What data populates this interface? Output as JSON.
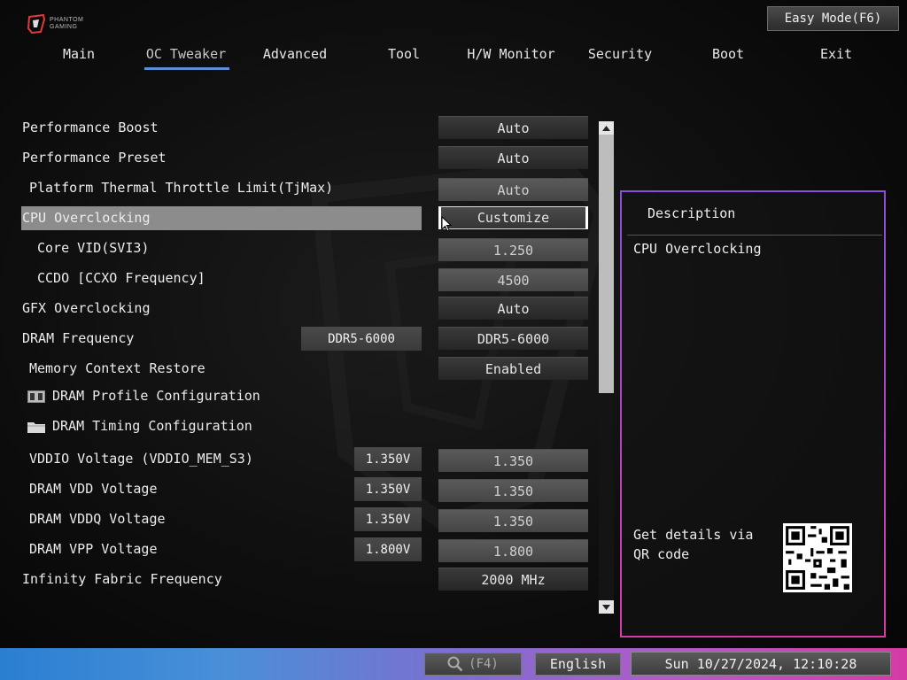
{
  "brand": {
    "logo_text_line1": "PHANTOM",
    "logo_text_line2": "GAMING"
  },
  "header": {
    "easy_mode_label": "Easy Mode(F6)"
  },
  "tabs": [
    {
      "label": "Main"
    },
    {
      "label": "OC Tweaker",
      "active": true
    },
    {
      "label": "Advanced"
    },
    {
      "label": "Tool"
    },
    {
      "label": "H/W Monitor"
    },
    {
      "label": "Security"
    },
    {
      "label": "Boot"
    },
    {
      "label": "Exit"
    }
  ],
  "settings": [
    {
      "label": "Performance Boost",
      "value": "Auto"
    },
    {
      "label": "Performance Preset",
      "value": "Auto"
    },
    {
      "label": "Platform Thermal Throttle Limit(TjMax)",
      "value": "Auto"
    },
    {
      "label": "CPU Overclocking",
      "value": "Customize"
    },
    {
      "label": "Core VID(SVI3)",
      "value": "1.250"
    },
    {
      "label": "CCDO [CCXO Frequency]",
      "value": "4500"
    },
    {
      "label": "GFX Overclocking",
      "value": "Auto"
    },
    {
      "label": "DRAM Frequency",
      "current": "DDR5-6000",
      "value": "DDR5-6000"
    },
    {
      "label": "Memory Context Restore",
      "value": "Enabled"
    },
    {
      "label": "DRAM Profile Configuration"
    },
    {
      "label": "DRAM Timing Configuration"
    },
    {
      "label": "VDDIO Voltage (VDDIO_MEM_S3)",
      "current": "1.350V",
      "value": "1.350"
    },
    {
      "label": "DRAM VDD Voltage",
      "current": "1.350V",
      "value": "1.350"
    },
    {
      "label": "DRAM VDDQ Voltage",
      "current": "1.350V",
      "value": "1.350"
    },
    {
      "label": "DRAM VPP Voltage",
      "current": "1.800V",
      "value": "1.800"
    },
    {
      "label": "Infinity Fabric Frequency",
      "value": "2000 MHz"
    }
  ],
  "description": {
    "title": "Description",
    "text": "CPU Overclocking",
    "qr_text": "Get details via QR code"
  },
  "footer": {
    "search_hint": "(F4)",
    "language": "English",
    "datetime": "Sun 10/27/2024, 12:10:28"
  },
  "colors": {
    "tab_underline": "#5b8fd4",
    "panel_border_top": "#8a4fd8",
    "panel_border_bottom": "#d83aa8",
    "bar_left": "#2a7fd2",
    "bar_right": "#d63aa6"
  }
}
